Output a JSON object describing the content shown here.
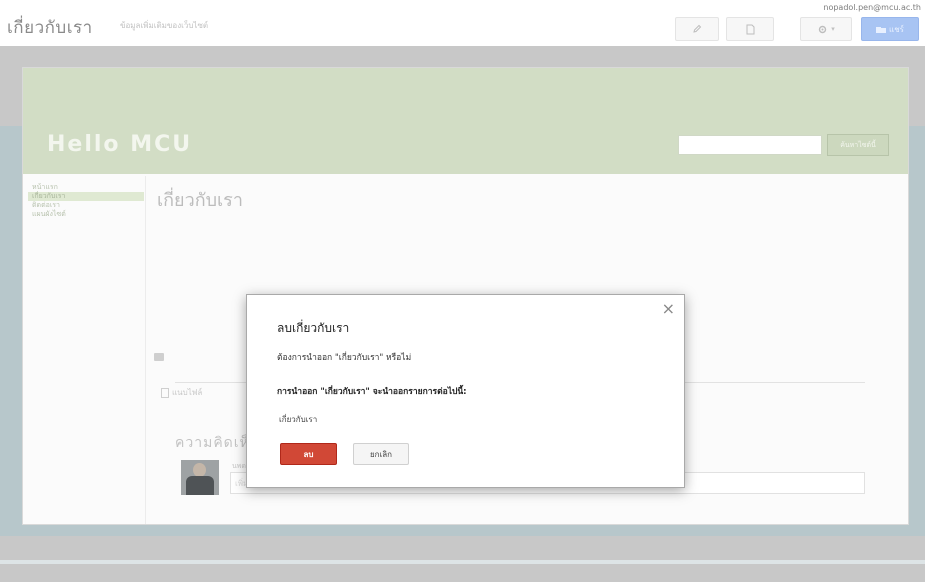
{
  "topbar": {
    "site_title": "เกี่ยวกับเรา",
    "site_subtitle": "ข้อมูลเพิ่มเติมของเว็บไซต์",
    "user_email": "nopadol.pen@mcu.ac.th",
    "share_label": "แชร์"
  },
  "site": {
    "header_title": "Hello MCU",
    "search_button": "ค้นหาไซต์นี้",
    "nav": [
      "หน้าแรก",
      "เกี่ยวกับเรา",
      "ติดต่อเรา",
      "แผนผังไซต์"
    ],
    "page_title": "เกี่ยวกับเรา",
    "attach_label": "แนบไฟล์",
    "comments_title": "ความคิดเห็น",
    "commenter_name": "นพดล",
    "comment_placeholder": "เพิ่มความคิดเห็น"
  },
  "dialog": {
    "title": "ลบเกี่ยวกับเรา",
    "message": "ต้องการนำออก \"เกี่ยวกับเรา\" หรือไม่",
    "warning": "การนำออก \"เกี่ยวกับเรา\" จะนำออกรายการต่อไปนี้:",
    "item": "เกี่ยวกับเรา",
    "delete_label": "ลบ",
    "cancel_label": "ยกเลิก",
    "close_glyph": "×"
  },
  "colors": {
    "delete_button": "#d14836",
    "share_button": "#a8c4f3",
    "site_header": "#d2ddc5",
    "overlay": "#c8c8c8"
  }
}
